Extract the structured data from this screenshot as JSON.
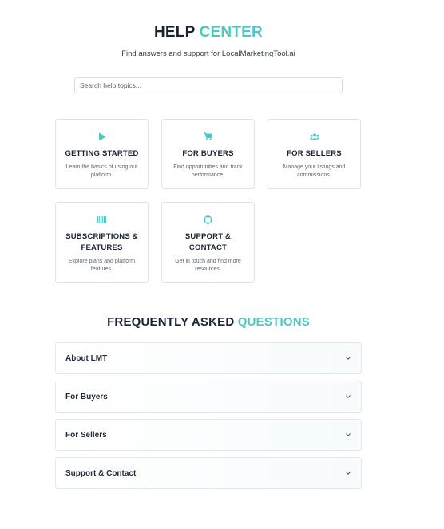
{
  "header": {
    "title_dark": "HELP",
    "title_accent": "CENTER",
    "subtitle": "Find answers and support for LocalMarketingTool.ai"
  },
  "search": {
    "placeholder": "Search help topics..."
  },
  "categories": [
    {
      "title": "GETTING STARTED",
      "description": "Learn the basics of using our platform.",
      "icon": "play-icon"
    },
    {
      "title": "FOR BUYERS",
      "description": "Find opportunities and track performance.",
      "icon": "cart-icon"
    },
    {
      "title": "FOR SELLERS",
      "description": "Manage your listings and commissions.",
      "icon": "users-icon"
    },
    {
      "title": "SUBSCRIPTIONS & FEATURES",
      "description": "Explore plans and platform features.",
      "icon": "barcode-icon"
    },
    {
      "title": "SUPPORT & CONTACT",
      "description": "Get in touch and find more resources.",
      "icon": "lifebuoy-icon"
    }
  ],
  "faq": {
    "title_dark": "FREQUENTLY ASKED",
    "title_accent": "QUESTIONS",
    "items": [
      {
        "question": "About LMT"
      },
      {
        "question": "For Buyers"
      },
      {
        "question": "For Sellers"
      },
      {
        "question": "Support & Contact"
      }
    ]
  },
  "colors": {
    "accent": "#4ec7c2",
    "heading": "#1b2330",
    "border": "#dfe3e7"
  }
}
